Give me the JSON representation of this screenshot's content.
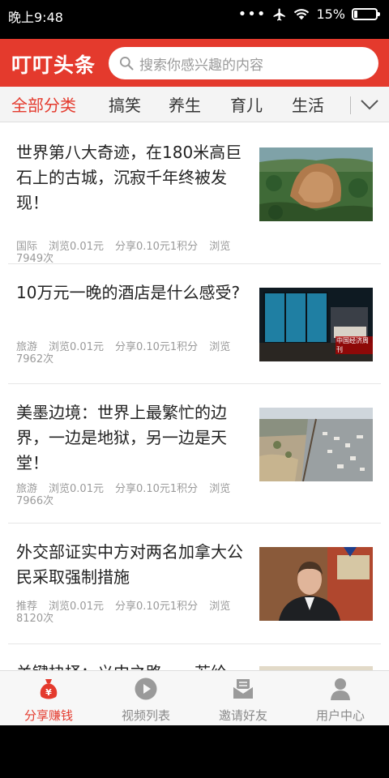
{
  "status_bar": {
    "time": "晚上9:48",
    "battery": "15%",
    "battery_level": 0.15
  },
  "header": {
    "app_title": "叮叮头条",
    "search_placeholder": "搜索你感兴趣的内容",
    "accent_color": "#e43a2d"
  },
  "categories": {
    "items": [
      "全部分类",
      "搞笑",
      "养生",
      "育儿",
      "生活"
    ],
    "active": "全部分类"
  },
  "articles": [
    {
      "title": "世界第八大奇迹，在180米高巨石上的古城，沉寂千年终被发现！",
      "tag": "国际",
      "browse_reward": "浏览0.01元",
      "share_reward": "分享0.10元1积分",
      "views": "浏览7949次",
      "thumb_icon": "rock-fortress-photo"
    },
    {
      "title": "10万元一晚的酒店是什么感受?",
      "tag": "旅游",
      "browse_reward": "浏览0.01元",
      "share_reward": "分享0.10元1积分",
      "views": "浏览7962次",
      "thumb_icon": "underwater-hotel-photo",
      "thumb_watermark": "中国经济周刊"
    },
    {
      "title": "美墨边境：世界上最繁忙的边界，一边是地狱，另一边是天堂！",
      "tag": "旅游",
      "browse_reward": "浏览0.01元",
      "share_reward": "分享0.10元1积分",
      "views": "浏览7966次",
      "thumb_icon": "border-aerial-photo"
    },
    {
      "title": "外交部证实中方对两名加拿大公民采取强制措施",
      "tag": "推荐",
      "browse_reward": "浏览0.01元",
      "share_reward": "分享0.10元1积分",
      "views": "浏览8120次",
      "thumb_icon": "man-portrait-photo"
    },
    {
      "title": "关键抉择：义中之路……若给",
      "thumb_icon": "partial-photo"
    }
  ],
  "bottom_nav": {
    "items": [
      {
        "label": "分享赚钱",
        "icon": "money-bag-icon"
      },
      {
        "label": "视频列表",
        "icon": "play-icon"
      },
      {
        "label": "邀请好友",
        "icon": "envelope-icon"
      },
      {
        "label": "用户中心",
        "icon": "user-icon"
      }
    ],
    "active_index": 0
  }
}
